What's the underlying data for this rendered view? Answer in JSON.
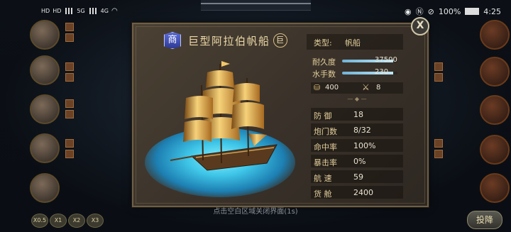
{
  "status_bar": {
    "left_labels": [
      "HD",
      "HD",
      "5G",
      "4G"
    ],
    "battery": "100%",
    "time": "4:25"
  },
  "top_sliver_text": "…",
  "dialog": {
    "badge": "商",
    "title": "巨型阿拉伯帆船",
    "tier_badge": "巨",
    "close": "X",
    "type_label": "类型:",
    "type_value": "帆船",
    "durability_label": "耐久度",
    "durability_value": "37500",
    "durability_fill": 0.92,
    "crew_label": "水手数",
    "crew_value": "230",
    "crew_fill": 0.92,
    "gold_value": "400",
    "attack_value": "8",
    "stats": [
      {
        "label": "防 御",
        "value": "18"
      },
      {
        "label": "炮门数",
        "value": "8/32"
      },
      {
        "label": "命中率",
        "value": "100%"
      },
      {
        "label": "暴击率",
        "value": "0%"
      },
      {
        "label": "航 速",
        "value": "59"
      },
      {
        "label": "货 舱",
        "value": "2400"
      }
    ]
  },
  "hint": "点击空白区域关闭界面(1s)",
  "speed_buttons": [
    "X0.5",
    "X1",
    "X2",
    "X3"
  ],
  "fight_button": "投降",
  "colors": {
    "accent_gold": "#ecd9a8",
    "sea": "#3fc6e8",
    "badge_blue": "#3b49b0"
  }
}
